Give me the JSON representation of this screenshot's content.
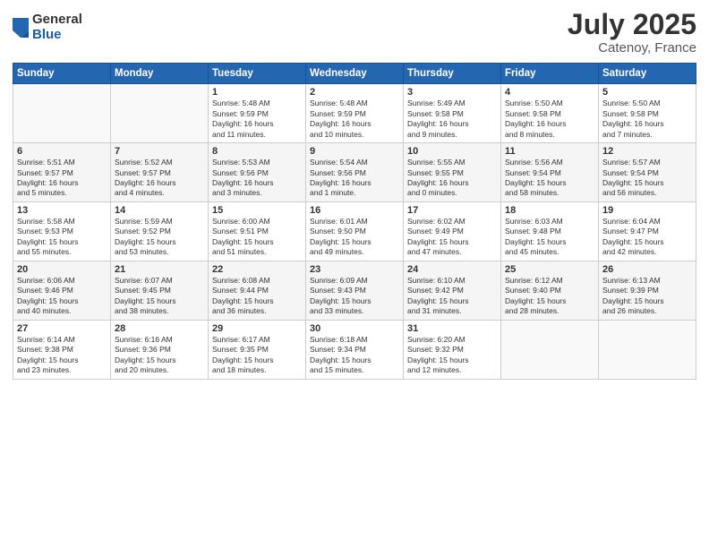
{
  "logo": {
    "general": "General",
    "blue": "Blue"
  },
  "title": "July 2025",
  "location": "Catenoy, France",
  "weekdays": [
    "Sunday",
    "Monday",
    "Tuesday",
    "Wednesday",
    "Thursday",
    "Friday",
    "Saturday"
  ],
  "weeks": [
    [
      {
        "day": "",
        "info": ""
      },
      {
        "day": "",
        "info": ""
      },
      {
        "day": "1",
        "info": "Sunrise: 5:48 AM\nSunset: 9:59 PM\nDaylight: 16 hours\nand 11 minutes."
      },
      {
        "day": "2",
        "info": "Sunrise: 5:48 AM\nSunset: 9:59 PM\nDaylight: 16 hours\nand 10 minutes."
      },
      {
        "day": "3",
        "info": "Sunrise: 5:49 AM\nSunset: 9:58 PM\nDaylight: 16 hours\nand 9 minutes."
      },
      {
        "day": "4",
        "info": "Sunrise: 5:50 AM\nSunset: 9:58 PM\nDaylight: 16 hours\nand 8 minutes."
      },
      {
        "day": "5",
        "info": "Sunrise: 5:50 AM\nSunset: 9:58 PM\nDaylight: 16 hours\nand 7 minutes."
      }
    ],
    [
      {
        "day": "6",
        "info": "Sunrise: 5:51 AM\nSunset: 9:57 PM\nDaylight: 16 hours\nand 5 minutes."
      },
      {
        "day": "7",
        "info": "Sunrise: 5:52 AM\nSunset: 9:57 PM\nDaylight: 16 hours\nand 4 minutes."
      },
      {
        "day": "8",
        "info": "Sunrise: 5:53 AM\nSunset: 9:56 PM\nDaylight: 16 hours\nand 3 minutes."
      },
      {
        "day": "9",
        "info": "Sunrise: 5:54 AM\nSunset: 9:56 PM\nDaylight: 16 hours\nand 1 minute."
      },
      {
        "day": "10",
        "info": "Sunrise: 5:55 AM\nSunset: 9:55 PM\nDaylight: 16 hours\nand 0 minutes."
      },
      {
        "day": "11",
        "info": "Sunrise: 5:56 AM\nSunset: 9:54 PM\nDaylight: 15 hours\nand 58 minutes."
      },
      {
        "day": "12",
        "info": "Sunrise: 5:57 AM\nSunset: 9:54 PM\nDaylight: 15 hours\nand 56 minutes."
      }
    ],
    [
      {
        "day": "13",
        "info": "Sunrise: 5:58 AM\nSunset: 9:53 PM\nDaylight: 15 hours\nand 55 minutes."
      },
      {
        "day": "14",
        "info": "Sunrise: 5:59 AM\nSunset: 9:52 PM\nDaylight: 15 hours\nand 53 minutes."
      },
      {
        "day": "15",
        "info": "Sunrise: 6:00 AM\nSunset: 9:51 PM\nDaylight: 15 hours\nand 51 minutes."
      },
      {
        "day": "16",
        "info": "Sunrise: 6:01 AM\nSunset: 9:50 PM\nDaylight: 15 hours\nand 49 minutes."
      },
      {
        "day": "17",
        "info": "Sunrise: 6:02 AM\nSunset: 9:49 PM\nDaylight: 15 hours\nand 47 minutes."
      },
      {
        "day": "18",
        "info": "Sunrise: 6:03 AM\nSunset: 9:48 PM\nDaylight: 15 hours\nand 45 minutes."
      },
      {
        "day": "19",
        "info": "Sunrise: 6:04 AM\nSunset: 9:47 PM\nDaylight: 15 hours\nand 42 minutes."
      }
    ],
    [
      {
        "day": "20",
        "info": "Sunrise: 6:06 AM\nSunset: 9:46 PM\nDaylight: 15 hours\nand 40 minutes."
      },
      {
        "day": "21",
        "info": "Sunrise: 6:07 AM\nSunset: 9:45 PM\nDaylight: 15 hours\nand 38 minutes."
      },
      {
        "day": "22",
        "info": "Sunrise: 6:08 AM\nSunset: 9:44 PM\nDaylight: 15 hours\nand 36 minutes."
      },
      {
        "day": "23",
        "info": "Sunrise: 6:09 AM\nSunset: 9:43 PM\nDaylight: 15 hours\nand 33 minutes."
      },
      {
        "day": "24",
        "info": "Sunrise: 6:10 AM\nSunset: 9:42 PM\nDaylight: 15 hours\nand 31 minutes."
      },
      {
        "day": "25",
        "info": "Sunrise: 6:12 AM\nSunset: 9:40 PM\nDaylight: 15 hours\nand 28 minutes."
      },
      {
        "day": "26",
        "info": "Sunrise: 6:13 AM\nSunset: 9:39 PM\nDaylight: 15 hours\nand 26 minutes."
      }
    ],
    [
      {
        "day": "27",
        "info": "Sunrise: 6:14 AM\nSunset: 9:38 PM\nDaylight: 15 hours\nand 23 minutes."
      },
      {
        "day": "28",
        "info": "Sunrise: 6:16 AM\nSunset: 9:36 PM\nDaylight: 15 hours\nand 20 minutes."
      },
      {
        "day": "29",
        "info": "Sunrise: 6:17 AM\nSunset: 9:35 PM\nDaylight: 15 hours\nand 18 minutes."
      },
      {
        "day": "30",
        "info": "Sunrise: 6:18 AM\nSunset: 9:34 PM\nDaylight: 15 hours\nand 15 minutes."
      },
      {
        "day": "31",
        "info": "Sunrise: 6:20 AM\nSunset: 9:32 PM\nDaylight: 15 hours\nand 12 minutes."
      },
      {
        "day": "",
        "info": ""
      },
      {
        "day": "",
        "info": ""
      }
    ]
  ]
}
